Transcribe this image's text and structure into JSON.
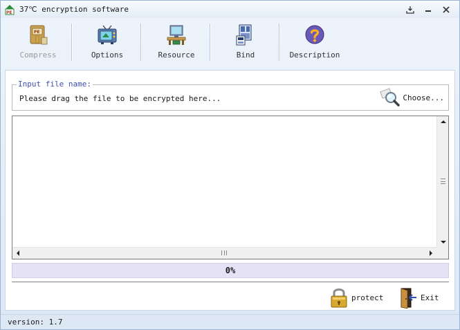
{
  "window": {
    "title": "37℃ encryption software",
    "app_icon_text": "PE"
  },
  "toolbar": {
    "items": [
      {
        "label": "Compress",
        "icon": "compress-pe-icon",
        "enabled": false
      },
      {
        "label": "Options",
        "icon": "options-tv-icon",
        "enabled": true
      },
      {
        "label": "Resource",
        "icon": "resource-computer-icon",
        "enabled": true
      },
      {
        "label": "Bind",
        "icon": "bind-icon",
        "enabled": true
      },
      {
        "label": "Description",
        "icon": "question-icon",
        "enabled": true
      }
    ]
  },
  "input": {
    "legend": "Input file name:",
    "placeholder": "Please drag the file to be encrypted here...",
    "choose_label": "Choose..."
  },
  "progress": {
    "value_percent": 0,
    "label": "0%"
  },
  "actions": {
    "protect_label": "protect",
    "exit_label": "Exit"
  },
  "status": {
    "version": "version: 1.7"
  },
  "colors": {
    "legend": "#3c50b4",
    "progress_bg": "#e4e2f4",
    "progress_fill": "#3d59c4"
  }
}
